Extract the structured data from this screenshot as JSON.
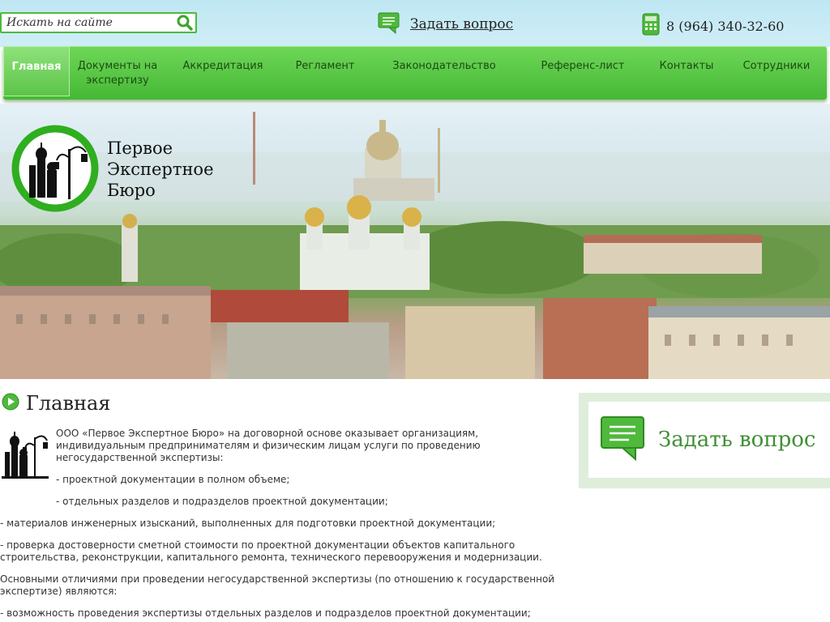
{
  "header": {
    "search_placeholder": "Искать на сайте",
    "ask_link": "Задать вопрос",
    "phone": "8 (964) 340-32-60"
  },
  "nav": {
    "items": [
      {
        "label": "Главная",
        "active": true
      },
      {
        "label": "Документы на экспертизу",
        "active": false
      },
      {
        "label": "Аккредитация",
        "active": false
      },
      {
        "label": "Регламент",
        "active": false
      },
      {
        "label": "Законодательство",
        "active": false
      },
      {
        "label": "Референс-лист",
        "active": false
      },
      {
        "label": "Контакты",
        "active": false
      },
      {
        "label": "Сотрудники",
        "active": false
      }
    ]
  },
  "logo": {
    "line1": "Первое",
    "line2": "Экспертное",
    "line3": "Бюро"
  },
  "main": {
    "title": "Главная",
    "paragraphs": [
      "ООО «Первое Экспертное Бюро» на договорной основе оказывает организациям, индивидуальным предпринимателям и физическим лицам услуги по проведению негосударственной экспертизы:",
      "- проектной документации в полном объеме;",
      "- отдельных разделов и подразделов проектной документации;",
      "- материалов инженерных изысканий, выполненных для подготовки проектной документации;",
      "- проверка достоверности сметной стоимости по проектной документации объектов капитального строительства, реконструкции, капитального ремонта, технического перевооружения и модернизации.",
      "Основными отличиями при проведении негосударственной экспертизы (по отношению к государственной экспертизе) являются:",
      "- возможность проведения экспертизы отдельных разделов и подразделов проектной документации;"
    ]
  },
  "sidebar": {
    "ask_label": "Задать вопрос"
  },
  "colors": {
    "nav_green": "#45b835",
    "accent_green": "#3f8f35",
    "topbar_blue": "#bfe7f3"
  }
}
